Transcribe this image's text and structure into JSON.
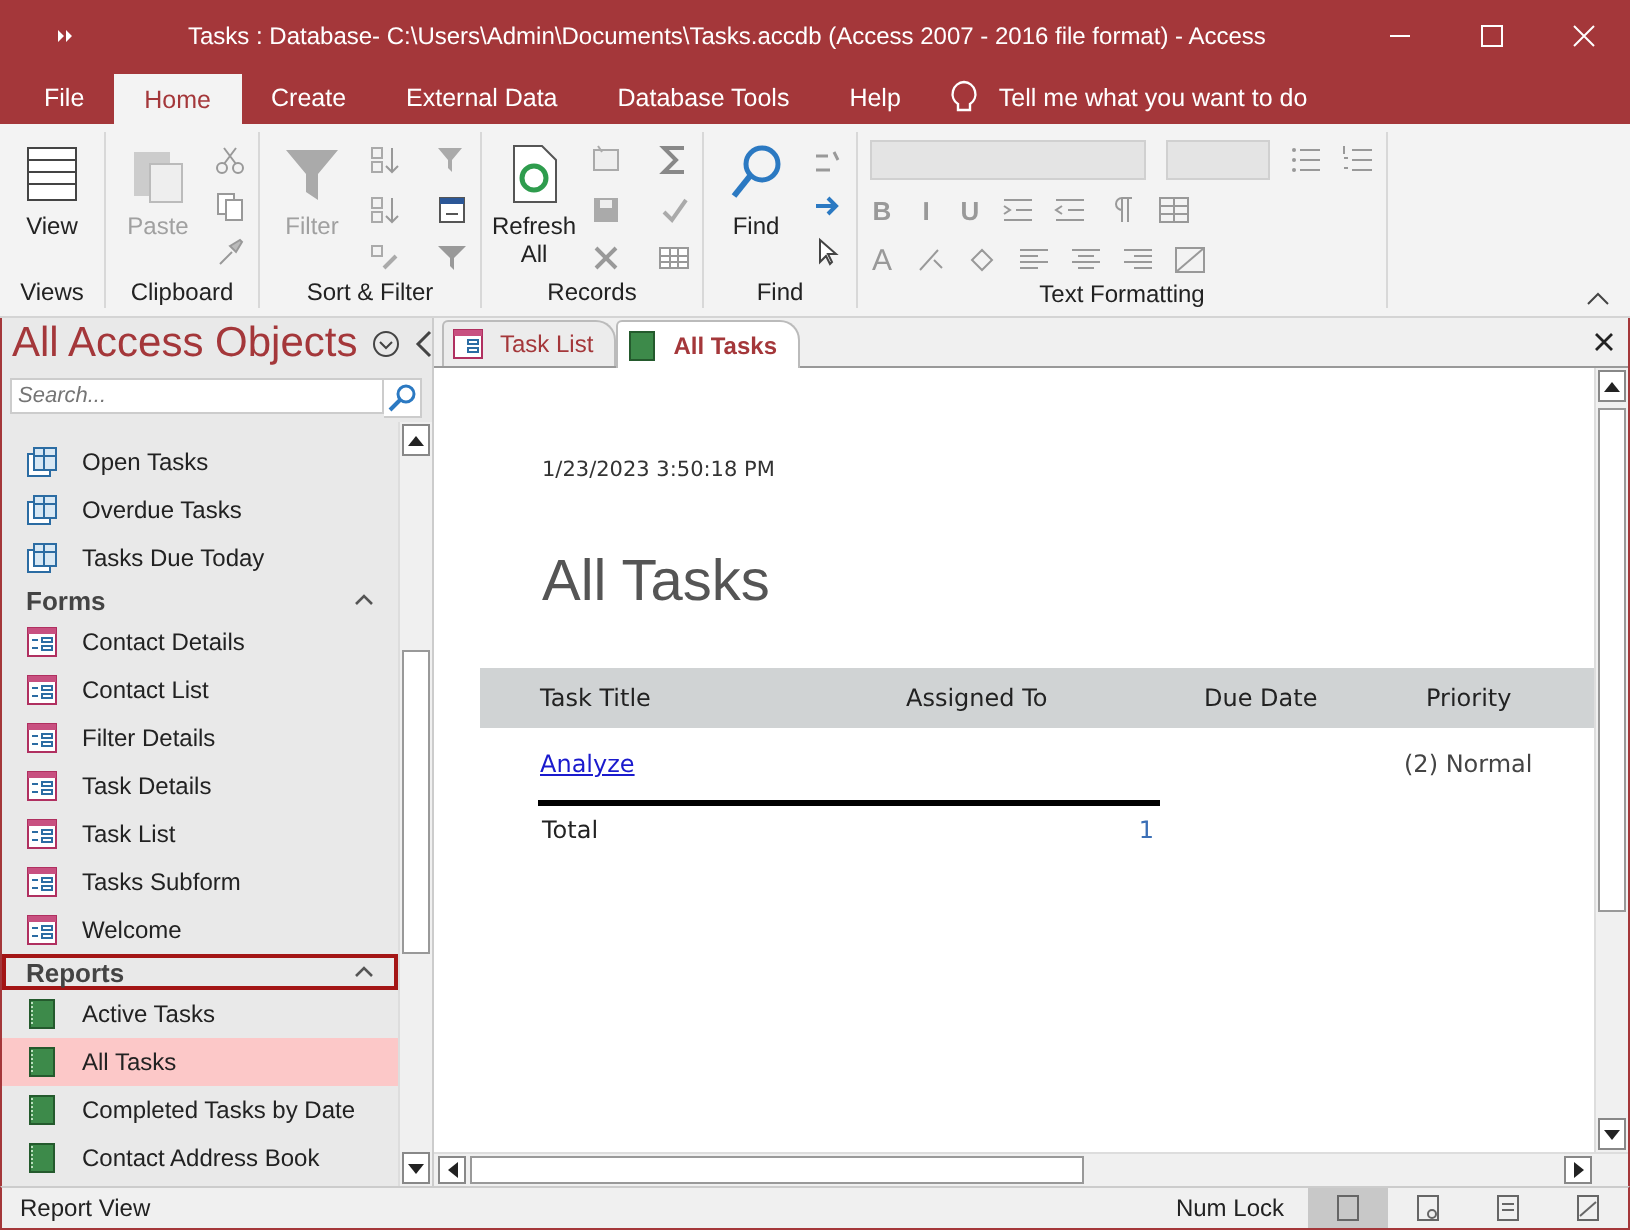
{
  "window": {
    "title": "Tasks : Database- C:\\Users\\Admin\\Documents\\Tasks.accdb (Access 2007 - 2016 file format)  -  Access"
  },
  "ribbon_tabs": [
    {
      "label": "File",
      "selected": false
    },
    {
      "label": "Home",
      "selected": true
    },
    {
      "label": "Create",
      "selected": false
    },
    {
      "label": "External Data",
      "selected": false
    },
    {
      "label": "Database Tools",
      "selected": false
    },
    {
      "label": "Help",
      "selected": false
    }
  ],
  "tell_me": {
    "placeholder": "Tell me what you want to do"
  },
  "ribbon_groups": [
    {
      "label": "Views",
      "buttons": [
        {
          "label": "View",
          "disabled": false
        }
      ]
    },
    {
      "label": "Clipboard",
      "buttons": [
        {
          "label": "Paste",
          "disabled": true
        }
      ]
    },
    {
      "label": "Sort & Filter",
      "buttons": [
        {
          "label": "Filter",
          "disabled": true
        }
      ]
    },
    {
      "label": "Records",
      "buttons": [
        {
          "label": "Refresh All",
          "disabled": false
        }
      ]
    },
    {
      "label": "Find",
      "buttons": [
        {
          "label": "Find",
          "disabled": false
        }
      ]
    },
    {
      "label": "Text Formatting",
      "glyphs": [
        "B",
        "I",
        "U",
        "A"
      ]
    }
  ],
  "nav": {
    "title": "All Access Objects",
    "search": {
      "placeholder": "Search..."
    },
    "groups": [
      {
        "items": [
          {
            "label": "Open Tasks",
            "kind": "query",
            "selected": false
          },
          {
            "label": "Overdue Tasks",
            "kind": "query",
            "selected": false
          },
          {
            "label": "Tasks Due Today",
            "kind": "query",
            "selected": false
          }
        ]
      },
      {
        "label": "Forms",
        "expanded": true,
        "focused": false,
        "items": [
          {
            "label": "Contact Details",
            "kind": "form",
            "selected": false
          },
          {
            "label": "Contact List",
            "kind": "form",
            "selected": false
          },
          {
            "label": "Filter Details",
            "kind": "form",
            "selected": false
          },
          {
            "label": "Task Details",
            "kind": "form",
            "selected": false
          },
          {
            "label": "Task List",
            "kind": "form",
            "selected": false
          },
          {
            "label": "Tasks Subform",
            "kind": "form",
            "selected": false
          },
          {
            "label": "Welcome",
            "kind": "form",
            "selected": false
          }
        ]
      },
      {
        "label": "Reports",
        "expanded": true,
        "focused": true,
        "items": [
          {
            "label": "Active Tasks",
            "kind": "report",
            "selected": false
          },
          {
            "label": "All Tasks",
            "kind": "report",
            "selected": true
          },
          {
            "label": "Completed Tasks by Date",
            "kind": "report",
            "selected": false
          },
          {
            "label": "Contact Address Book",
            "kind": "report",
            "selected": false
          }
        ]
      }
    ]
  },
  "doc_tabs": [
    {
      "label": "Task List",
      "kind": "form",
      "selected": false
    },
    {
      "label": "All Tasks",
      "kind": "report",
      "selected": true
    }
  ],
  "report": {
    "date": "1/23/2023 3:50:18 PM",
    "title": "All Tasks",
    "columns": [
      "Task Title",
      "Assigned To",
      "Due Date",
      "Priority"
    ],
    "rows": [
      {
        "task_title": "Analyze",
        "priority": "(2) Normal"
      }
    ],
    "total_label": "Total",
    "total_value": "1"
  },
  "status_bar": {
    "text": "Report View",
    "indicators": [
      "Num Lock"
    ],
    "views": [
      {
        "kind": "report",
        "selected": true
      },
      {
        "kind": "preview",
        "selected": false
      },
      {
        "kind": "layout",
        "selected": false
      },
      {
        "kind": "design",
        "selected": false
      }
    ]
  }
}
